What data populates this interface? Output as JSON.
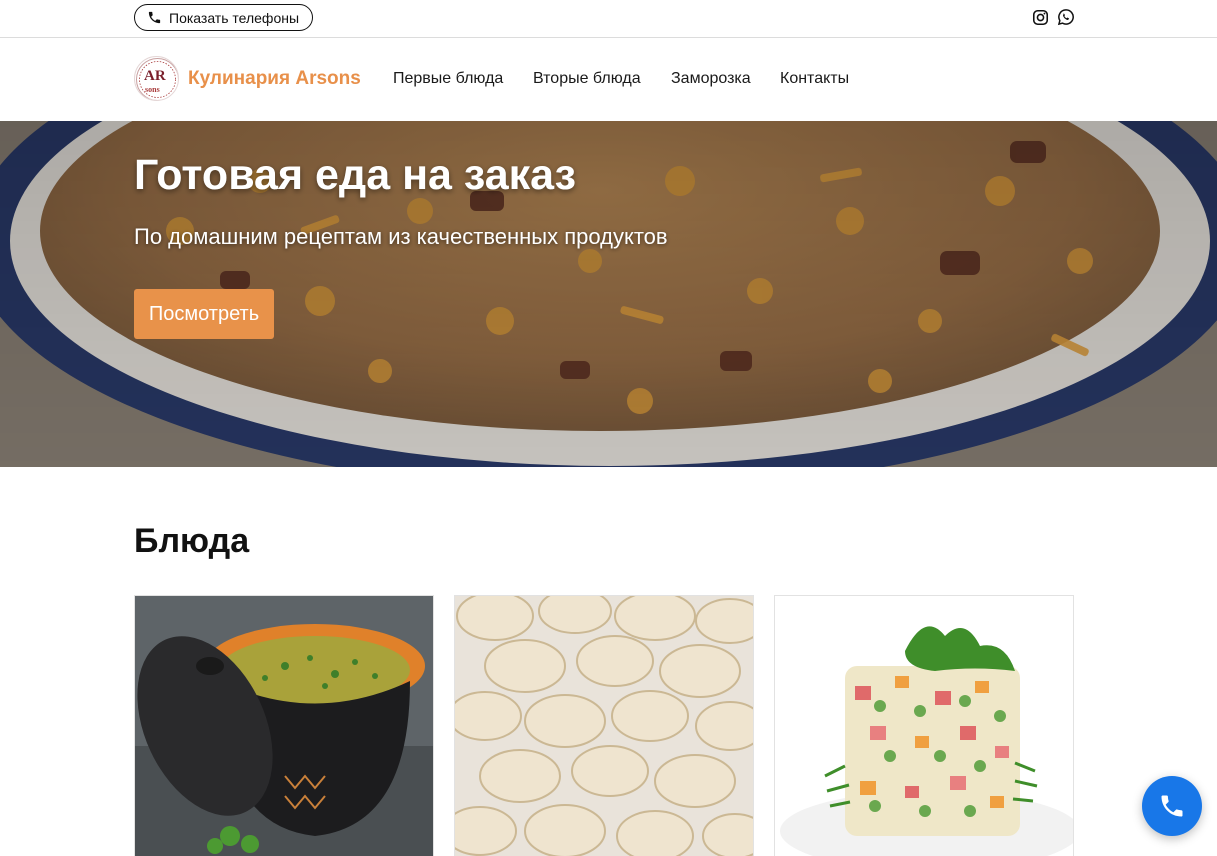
{
  "topbar": {
    "show_phones_label": "Показать телефоны",
    "phone_icon": "phone-icon",
    "social": [
      "instagram-icon",
      "whatsapp-icon"
    ]
  },
  "header": {
    "brand": "Кулинария Arsons",
    "logo_text_top": "AR",
    "logo_text_bottom": "sons",
    "nav": [
      {
        "label": "Первые блюда"
      },
      {
        "label": "Вторые блюда"
      },
      {
        "label": "Заморозка"
      },
      {
        "label": "Контакты"
      }
    ]
  },
  "hero": {
    "title": "Готовая еда на заказ",
    "subtitle": "По домашним рецептам из качественных продуктов",
    "button_label": "Посмотреть"
  },
  "dishes": {
    "title": "Блюда",
    "cards": [
      {
        "image": "soup-pot-image"
      },
      {
        "image": "pelmeni-image"
      },
      {
        "image": "olivier-salad-image"
      }
    ]
  },
  "colors": {
    "accent": "#e8904a",
    "call_button": "#1877e8"
  }
}
